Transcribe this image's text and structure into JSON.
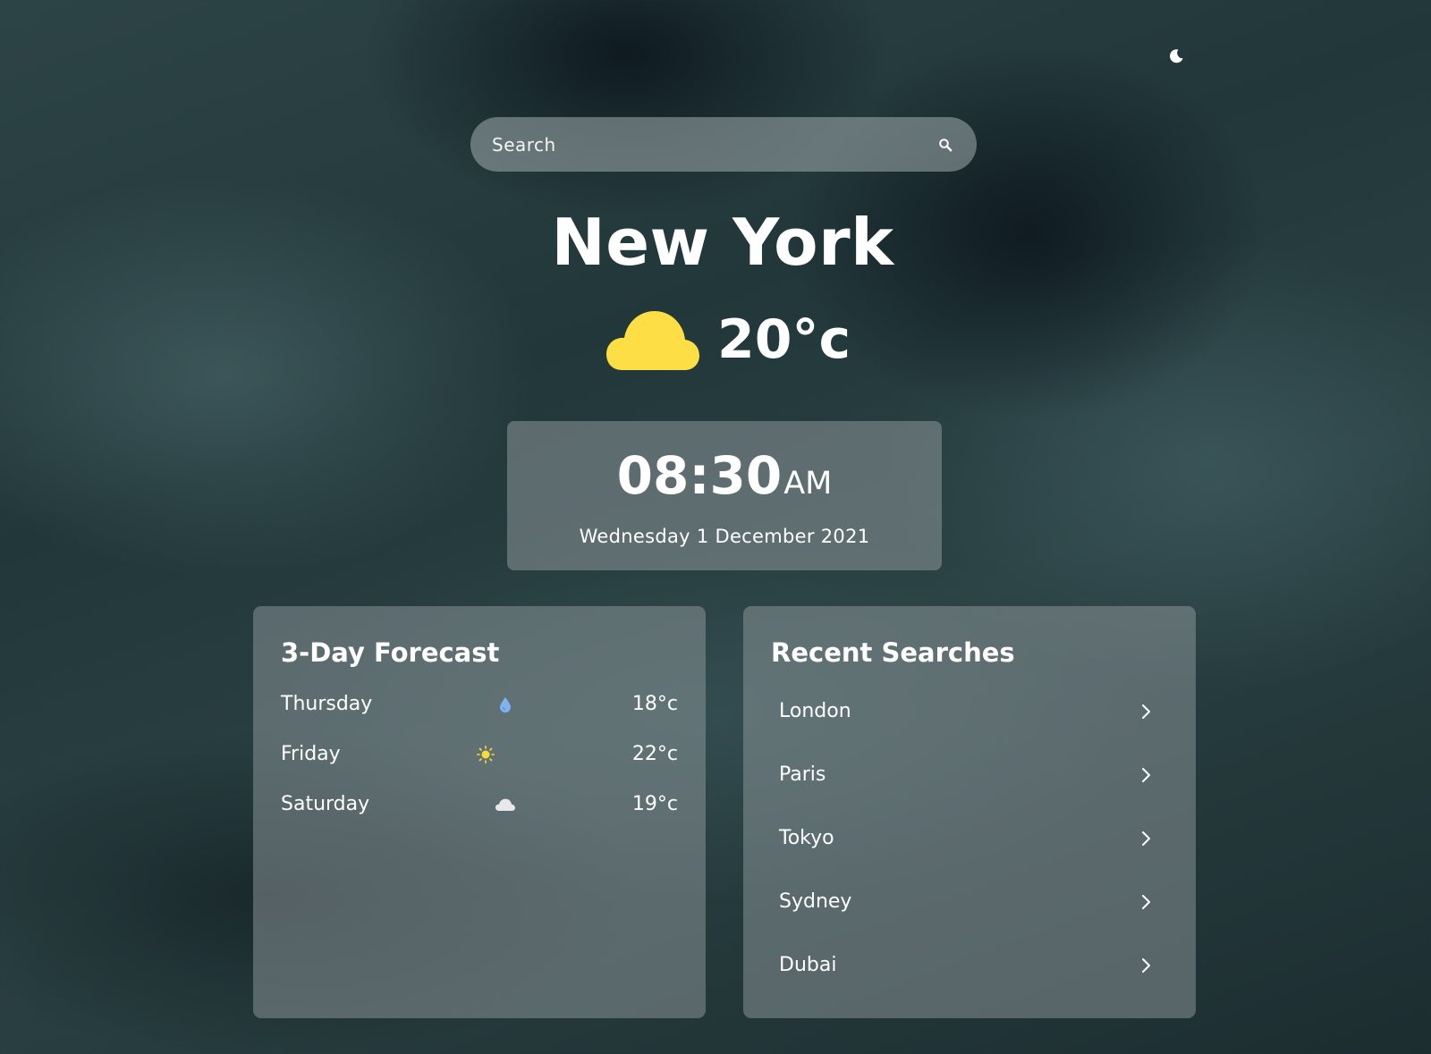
{
  "header": {
    "theme_toggle_icon": "moon-icon"
  },
  "search": {
    "placeholder": "Search",
    "value": "",
    "icon": "search-icon"
  },
  "current": {
    "city": "New York",
    "temperature": "20°c",
    "condition_icon": "cloud-icon",
    "condition_color": "#FDDE45"
  },
  "clock": {
    "time": "08:30",
    "ampm": "AM",
    "date": "Wednesday 1 December 2021"
  },
  "forecast": {
    "title": "3-Day Forecast",
    "days": [
      {
        "day": "Thursday",
        "icon": "raindrop-icon",
        "icon_color": "#7FB2F0",
        "temp": "18°c"
      },
      {
        "day": "Friday",
        "icon": "sun-icon",
        "icon_color": "#F9DB3A",
        "temp": "22°c"
      },
      {
        "day": "Saturday",
        "icon": "cloud-icon",
        "icon_color": "#E6E8EA",
        "temp": "19°c"
      }
    ]
  },
  "recent": {
    "title": "Recent Searches",
    "items": [
      {
        "label": "London"
      },
      {
        "label": "Paris"
      },
      {
        "label": "Tokyo"
      },
      {
        "label": "Sydney"
      },
      {
        "label": "Dubai"
      }
    ]
  }
}
